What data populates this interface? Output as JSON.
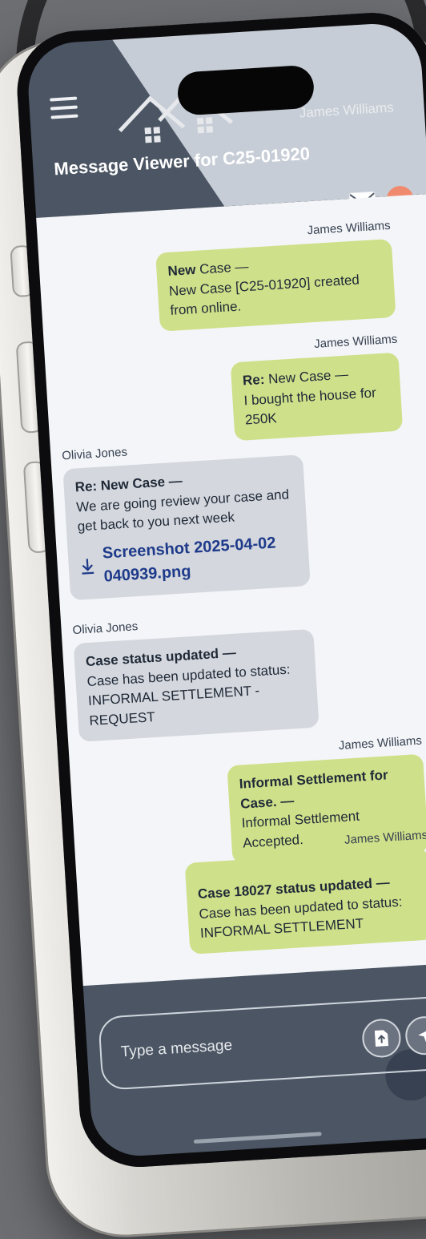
{
  "app": {
    "header_user": "James Williams",
    "title": "Message Viewer for C25-01920",
    "close_label": "x"
  },
  "messages": [
    {
      "sender": "James Williams",
      "direction": "out",
      "subject": "New",
      "subject_rest": " Case —",
      "body": "New Case [C25-01920] created from online."
    },
    {
      "sender": "James Williams",
      "direction": "out",
      "subject": "Re:",
      "subject_rest": " New Case —",
      "body": "I bought the house for 250K"
    },
    {
      "sender": "Olivia Jones",
      "direction": "in",
      "subject": "Re: New Case —",
      "body": "We are going review your case and get back to you next week",
      "attachment": "Screenshot 2025-04-02 040939.png"
    },
    {
      "sender": "Olivia Jones",
      "direction": "in",
      "subject": "Case status updated —",
      "body": "Case has been updated to status: INFORMAL SETTLEMENT - REQUEST"
    },
    {
      "sender": "James Williams",
      "direction": "out",
      "subject": "Informal Settlement for Case. —",
      "body": "Informal Settlement Accepted."
    },
    {
      "sender": "James Williams",
      "direction": "out",
      "subject": "Case 18027 status updated —",
      "body": "Case has been updated to status: INFORMAL SETTLEMENT"
    }
  ],
  "composer": {
    "placeholder": "Type a message"
  },
  "colors": {
    "header": "#4b5563",
    "outgoing_bubble": "#cfe08a",
    "incoming_bubble": "#d4d7dd",
    "close_button": "#f08a6e",
    "attachment_link": "#1e3a8a"
  },
  "icons": [
    "menu-icon",
    "house-icon",
    "mail-icon",
    "close-icon",
    "download-icon",
    "upload-file-icon",
    "send-icon"
  ]
}
